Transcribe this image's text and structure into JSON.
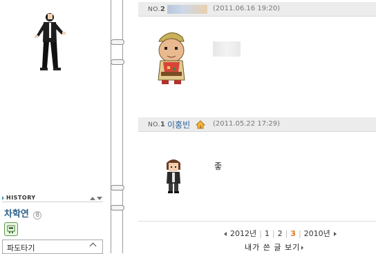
{
  "posts": [
    {
      "no_label": "NO.",
      "no": "2",
      "author": "",
      "date": "(2011.06.16 19:20)",
      "comment": ""
    },
    {
      "no_label": "NO.",
      "no": "1",
      "author": "이홍빈",
      "date": "(2011.05.22 17:29)",
      "comment": "좋"
    }
  ],
  "pager": {
    "prev_year": "2012년",
    "pages": [
      "1",
      "2",
      "3"
    ],
    "current_page": "3",
    "next_year": "2010년",
    "my_posts_link": "내가 쓴 글 보기"
  },
  "sidebar": {
    "history_label": "HISTORY",
    "owner_name": "차학연",
    "owner_count": "8",
    "dropdown_value": "파도타기"
  },
  "icons": {
    "home": "home-icon",
    "prev": "triangle-left-icon",
    "next": "triangle-right-icon",
    "history_up": "triangle-up-icon",
    "history_down": "triangle-down-icon",
    "dropdown": "chevron-up-icon",
    "minihome": "minihome-icon"
  },
  "colors": {
    "accent_orange": "#e0781c",
    "link_blue": "#2a6099",
    "header_gray": "#ececec"
  }
}
